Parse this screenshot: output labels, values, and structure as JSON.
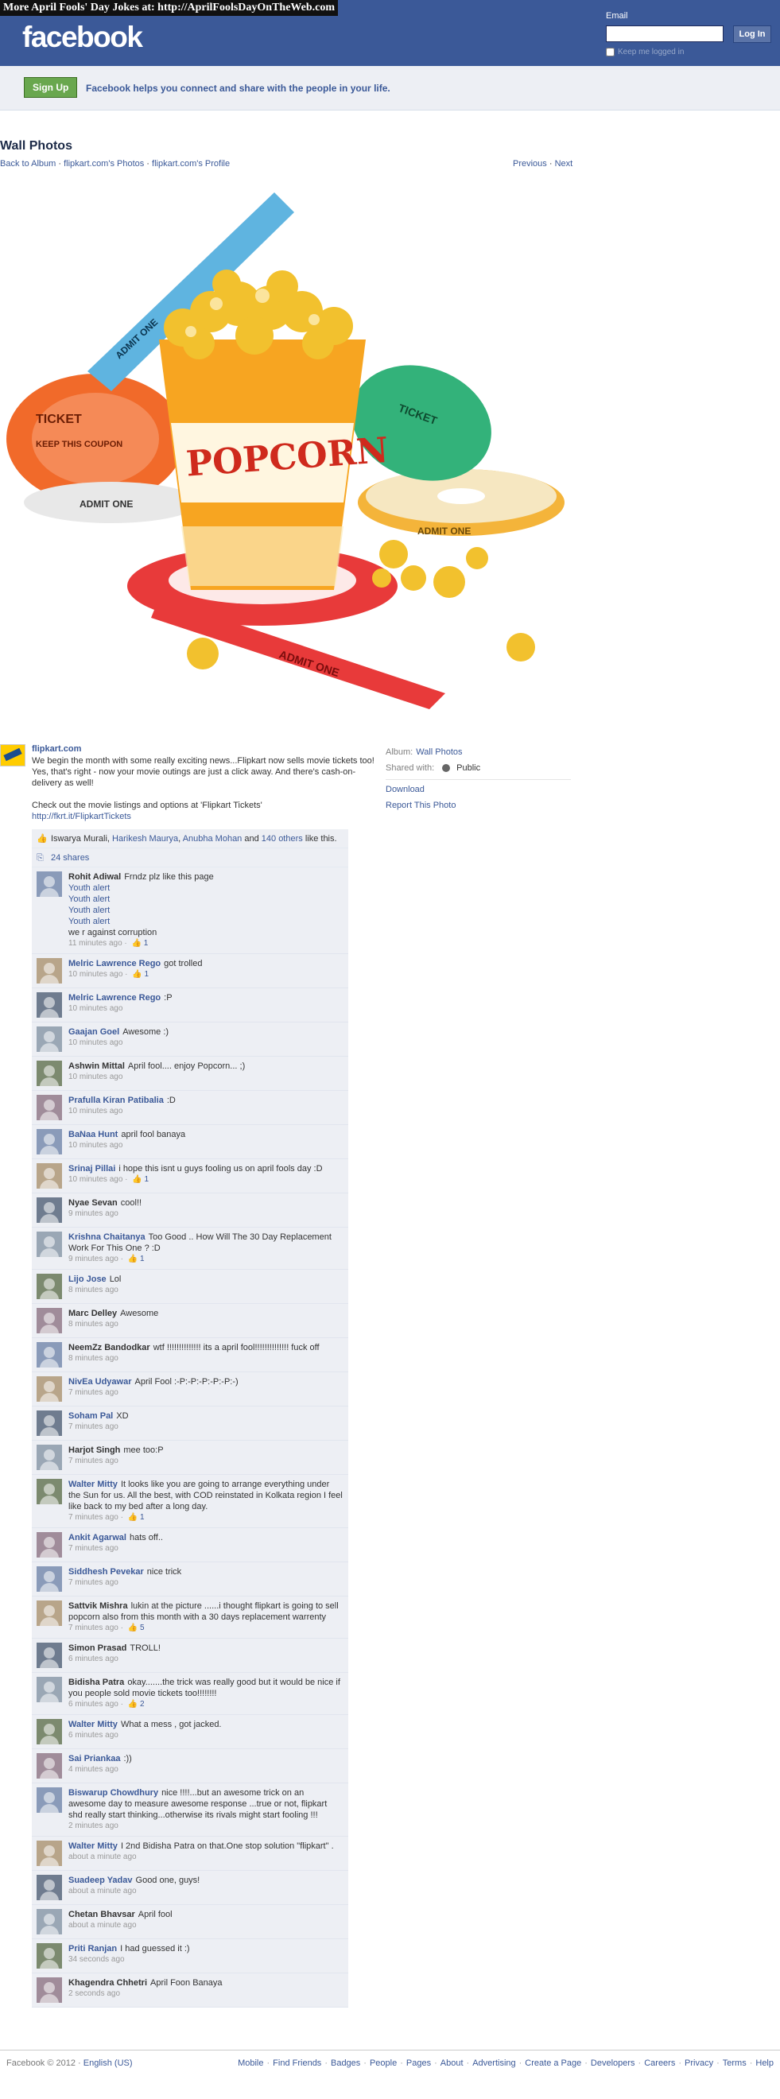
{
  "overlay_banner": "More April Fools' Day Jokes at: http://AprilFoolsDayOnTheWeb.com",
  "header": {
    "logo": "facebook",
    "email_label": "Email",
    "login_button": "Log In",
    "keep_logged_in": "Keep me logged in"
  },
  "signup": {
    "button": "Sign Up",
    "tagline": "Facebook helps you connect and share with the people in your life."
  },
  "page": {
    "title": "Wall Photos",
    "breadcrumbs": [
      "Back to Album",
      "flipkart.com's Photos",
      "flipkart.com's Profile"
    ],
    "breadcrumb_sep": " · ",
    "previous": "Previous",
    "next": "Next",
    "pager_sep": " · "
  },
  "photo": {
    "tickets": [
      "TICKET",
      "KEEP THIS COUPON",
      "ADMIT ONE"
    ],
    "bucket_text": "POPCORN",
    "colors": {
      "popcorn": "#f2c12e",
      "bucket": "#f7a521",
      "bucket_red": "#cf2a1d",
      "ticket_blue": "#5fb4e0",
      "ticket_green": "#33b27a",
      "ticket_orange": "#f16a2a",
      "ticket_yellow": "#f4b43a",
      "ticket_white": "#e8e8e8",
      "ticket_red": "#e83a3a"
    }
  },
  "post": {
    "author": "flipkart.com",
    "body_paragraph_1": "We begin the month with some really exciting news...Flipkart now sells movie tickets too! Yes, that's right - now your movie outings are just a click away. And there's cash-on-delivery as well!",
    "body_paragraph_2": "Check out the movie listings and options at 'Flipkart Tickets'",
    "link": "http://fkrt.it/FlipkartTickets"
  },
  "sidebar": {
    "album_label": "Album:",
    "album_value": "Wall Photos",
    "shared_label": "Shared with:",
    "shared_value": "Public",
    "download": "Download",
    "report": "Report This Photo"
  },
  "likes": {
    "prefix": "Iswarya Murali, ",
    "name_2": "Harikesh Maurya",
    "sep_1": ", ",
    "name_3": "Anubha Mohan",
    "and": " and ",
    "others": "140 others",
    "suffix": " like this.",
    "shares": "24 shares"
  },
  "comments": [
    {
      "name": "Rohit Adiwal",
      "link": false,
      "text": "Frndz plz like this page",
      "extra_lines": [
        "Youth alert",
        "Youth alert",
        "Youth alert",
        "Youth alert"
      ],
      "extra_last": "we r against corruption",
      "time": "11 minutes ago",
      "likes": "1"
    },
    {
      "name": "Melric Lawrence Rego",
      "link": true,
      "text": "got trolled",
      "time": "10 minutes ago",
      "likes": "1"
    },
    {
      "name": "Melric Lawrence Rego",
      "link": true,
      "text": ":P",
      "time": "10 minutes ago",
      "likes": ""
    },
    {
      "name": "Gaajan Goel",
      "link": true,
      "text": "Awesome :)",
      "time": "10 minutes ago",
      "likes": ""
    },
    {
      "name": "Ashwin Mittal",
      "link": false,
      "text": "April fool.... enjoy Popcorn... ;)",
      "time": "10 minutes ago",
      "likes": ""
    },
    {
      "name": "Prafulla Kiran Patibalia",
      "link": true,
      "text": ":D",
      "time": "10 minutes ago",
      "likes": ""
    },
    {
      "name": "BaNaa Hunt",
      "link": true,
      "text": "april fool banaya",
      "time": "10 minutes ago",
      "likes": ""
    },
    {
      "name": "Srinaj Pillai",
      "link": true,
      "text": "i hope this isnt u guys fooling us on april fools day :D",
      "time": "10 minutes ago",
      "likes": "1"
    },
    {
      "name": "Nyae Sevan",
      "link": false,
      "text": "cool!!",
      "time": "9 minutes ago",
      "likes": ""
    },
    {
      "name": "Krishna Chaitanya",
      "link": true,
      "text": "Too Good .. How Will The 30 Day Replacement Work For This One ? :D",
      "time": "9 minutes ago",
      "likes": "1"
    },
    {
      "name": "Lijo Jose",
      "link": true,
      "text": "Lol",
      "time": "8 minutes ago",
      "likes": ""
    },
    {
      "name": "Marc Delley",
      "link": false,
      "text": "Awesome",
      "time": "8 minutes ago",
      "likes": ""
    },
    {
      "name": "NeemZz Bandodkar",
      "link": false,
      "text": "wtf !!!!!!!!!!!!!! its a april fool!!!!!!!!!!!!!! fuck off",
      "time": "8 minutes ago",
      "likes": ""
    },
    {
      "name": "NivEa Udyawar",
      "link": true,
      "text": "April Fool :-P:-P:-P:-P:-P:-)",
      "time": "7 minutes ago",
      "likes": ""
    },
    {
      "name": "Soham Pal",
      "link": true,
      "text": "XD",
      "time": "7 minutes ago",
      "likes": ""
    },
    {
      "name": "Harjot Singh",
      "link": false,
      "text": "mee too:P",
      "time": "7 minutes ago",
      "likes": ""
    },
    {
      "name": "Walter Mitty",
      "link": true,
      "text": "It looks like you are going to arrange everything under the Sun for us. All the best, with COD reinstated in Kolkata region I feel like back to my bed after a long day.",
      "time": "7 minutes ago",
      "likes": "1"
    },
    {
      "name": "Ankit Agarwal",
      "link": true,
      "text": "hats off..",
      "time": "7 minutes ago",
      "likes": ""
    },
    {
      "name": "Siddhesh Pevekar",
      "link": true,
      "text": "nice trick",
      "time": "7 minutes ago",
      "likes": ""
    },
    {
      "name": "Sattvik Mishra",
      "link": false,
      "text": "lukin at the picture ......i thought flipkart is going to sell popcorn also from this month with a 30 days replacement warrenty",
      "time": "7 minutes ago",
      "likes": "5"
    },
    {
      "name": "Simon Prasad",
      "link": false,
      "text": "TROLL!",
      "time": "6 minutes ago",
      "likes": ""
    },
    {
      "name": "Bidisha Patra",
      "link": false,
      "text": "okay.......the trick was really good but it would be nice if you people sold movie tickets too!!!!!!!!",
      "time": "6 minutes ago",
      "likes": "2"
    },
    {
      "name": "Walter Mitty",
      "link": true,
      "text": "What a mess , got jacked.",
      "time": "6 minutes ago",
      "likes": ""
    },
    {
      "name": "Sai Priankaa",
      "link": true,
      "text": ":))",
      "time": "4 minutes ago",
      "likes": ""
    },
    {
      "name": "Biswarup Chowdhury",
      "link": true,
      "text": "nice !!!!...but an awesome trick on an awesome day to measure awesome response ...true or not, flipkart shd really start thinking...otherwise its rivals might start fooling !!!",
      "time": "2 minutes ago",
      "likes": ""
    },
    {
      "name": "Walter Mitty",
      "link": true,
      "text": "I 2nd Bidisha Patra on that.One stop solution \"flipkart\" .",
      "time": "about a minute ago",
      "likes": ""
    },
    {
      "name": "Suadeep Yadav",
      "link": true,
      "text": "Good one, guys!",
      "time": "about a minute ago",
      "likes": ""
    },
    {
      "name": "Chetan Bhavsar",
      "link": false,
      "text": "April fool",
      "time": "about a minute ago",
      "likes": ""
    },
    {
      "name": "Priti Ranjan",
      "link": true,
      "text": "I had guessed it :)",
      "time": "34 seconds ago",
      "likes": ""
    },
    {
      "name": "Khagendra Chhetri",
      "link": false,
      "text": "April Foon Banaya",
      "time": "2 seconds ago",
      "likes": ""
    }
  ],
  "footer": {
    "copyright": "Facebook © 2012 · ",
    "language": "English (US)",
    "links": [
      "Mobile",
      "Find Friends",
      "Badges",
      "People",
      "Pages",
      "About",
      "Advertising",
      "Create a Page",
      "Developers",
      "Careers",
      "Privacy",
      "Terms",
      "Help"
    ]
  }
}
